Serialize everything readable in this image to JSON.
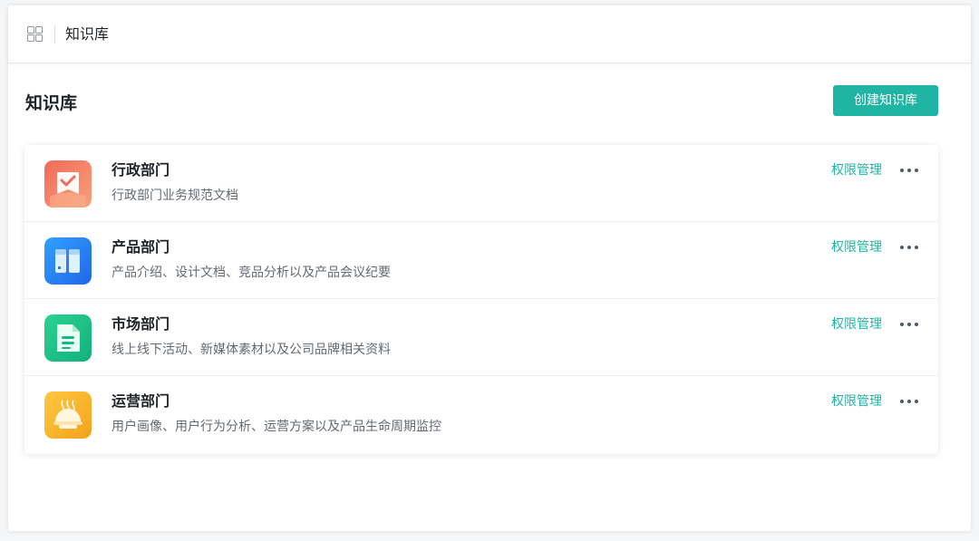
{
  "topbar": {
    "title": "知识库",
    "menu_icon": "grid-icon"
  },
  "main": {
    "title": "知识库",
    "create_button": "创建知识库"
  },
  "knowledge_bases": [
    {
      "name": "行政部门",
      "description": "行政部门业务规范文档",
      "action": "权限管理",
      "icon": "check-document-icon",
      "color": "#f07462"
    },
    {
      "name": "产品部门",
      "description": "产品介绍、设计文档、竞品分析以及产品会议纪要",
      "action": "权限管理",
      "icon": "binder-icon",
      "color": "#2a7bf0"
    },
    {
      "name": "市场部门",
      "description": "线上线下活动、新媒体素材以及公司品牌相关资料",
      "action": "权限管理",
      "icon": "file-document-icon",
      "color": "#1ec28b"
    },
    {
      "name": "运营部门",
      "description": "用户画像、用户行为分析、运营方案以及产品生命周期监控",
      "action": "权限管理",
      "icon": "food-dish-icon",
      "color": "#f5b124"
    }
  ],
  "colors": {
    "accent": "#1fb4a4"
  }
}
